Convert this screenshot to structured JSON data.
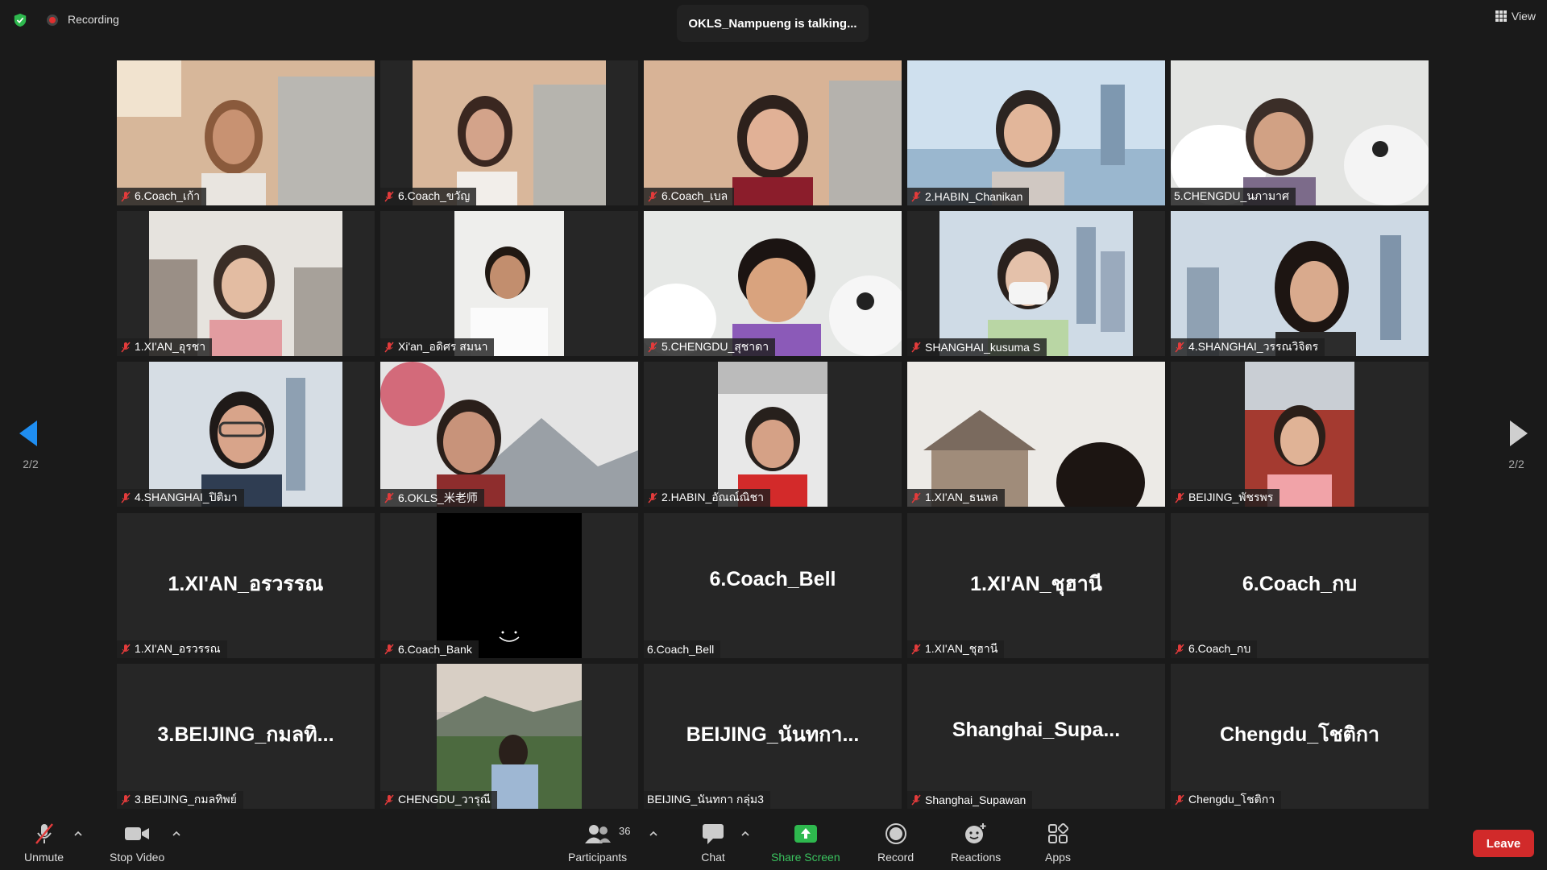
{
  "topbar": {
    "recording_label": "Recording",
    "talking_label": "OKLS_Nampueng is talking...",
    "view_label": "View"
  },
  "pagination": {
    "left_page": "2/2",
    "right_page": "2/2"
  },
  "tiles": [
    {
      "label": "6.Coach_เก้า",
      "muted": true
    },
    {
      "label": "6.Coach_ขวัญ",
      "muted": true
    },
    {
      "label": "6.Coach_เบล",
      "muted": true
    },
    {
      "label": "2.HABIN_Chanikan",
      "muted": true
    },
    {
      "label": "5.CHENGDU_นภามาศ",
      "muted": false
    },
    {
      "label": "1.XI'AN_อุรชา",
      "muted": true
    },
    {
      "label": "Xi'an_อดิศร สมนา",
      "muted": true
    },
    {
      "label": "5.CHENGDU_สุชาดา",
      "muted": true
    },
    {
      "label": "SHANGHAI_kusuma S",
      "muted": true
    },
    {
      "label": "4.SHANGHAI_วรรณวิจิตร",
      "muted": true
    },
    {
      "label": "4.SHANGHAI_ปิติมา",
      "muted": true
    },
    {
      "label": "6.OKLS_米老师",
      "muted": true
    },
    {
      "label": "2.HABIN_อัณณ์ณิชา",
      "muted": true
    },
    {
      "label": "1.XI'AN_ธนพล",
      "muted": true
    },
    {
      "label": "BEIJING_พัชรพร",
      "muted": true
    },
    {
      "label": "1.XI'AN_อรวรรณ",
      "big": "1.XI'AN_อรวรรณ",
      "muted": true
    },
    {
      "label": "6.Coach_Bank",
      "muted": true
    },
    {
      "label": "6.Coach_Bell",
      "big": "6.Coach_Bell",
      "muted": false
    },
    {
      "label": "1.XI'AN_ชุฮานี",
      "big": "1.XI'AN_ชุฮานี",
      "muted": true
    },
    {
      "label": "6.Coach_กบ",
      "big": "6.Coach_กบ",
      "muted": true
    },
    {
      "label": "3.BEIJING_กมลทิพย์",
      "big": "3.BEIJING_กมลทิ...",
      "muted": true
    },
    {
      "label": "CHENGDU_วารุณี",
      "muted": true
    },
    {
      "label": "BEIJING_นันทกา กลุ่ม3",
      "big": "BEIJING_นันทกา...",
      "muted": false
    },
    {
      "label": "Shanghai_Supawan",
      "big": "Shanghai_Supa...",
      "muted": true
    },
    {
      "label": "Chengdu_โชติกา",
      "big": "Chengdu_โชติกา",
      "muted": true
    }
  ],
  "toolbar": {
    "unmute": "Unmute",
    "stop_video": "Stop Video",
    "participants": "Participants",
    "participants_count": "36",
    "chat": "Chat",
    "share_screen": "Share Screen",
    "record": "Record",
    "reactions": "Reactions",
    "apps": "Apps",
    "leave": "Leave"
  }
}
